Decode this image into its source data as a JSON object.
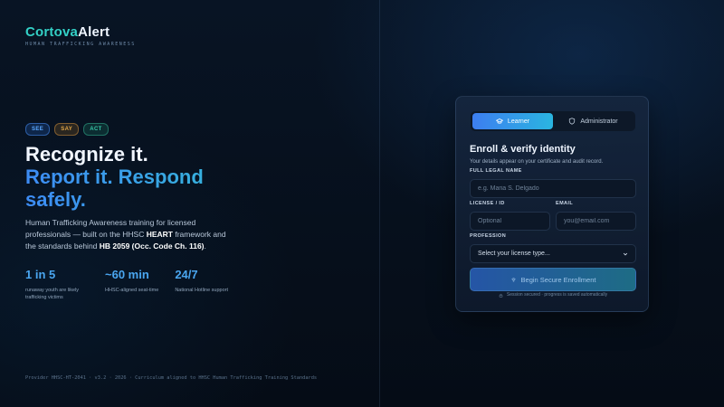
{
  "brand": {
    "name_part1": "Cortova",
    "name_part2": "Alert",
    "subtitle": "HUMAN TRAFFICKING AWARENESS"
  },
  "tags": [
    "SEE",
    "SAY",
    "ACT"
  ],
  "hero": {
    "line1": "Recognize it.",
    "line2": "Report it. Respond safely."
  },
  "description": {
    "text1": "Human Trafficking Awareness training for licensed professionals — built on the HHSC ",
    "bold1": "HEART",
    "text2": " framework and the standards behind ",
    "bold2": "HB 2059 (Occ. Code Ch. 116)",
    "text3": "."
  },
  "stats": [
    {
      "value": "1 in 5",
      "label": "runaway youth are likely trafficking victims"
    },
    {
      "value": "~60 min",
      "label": "HHSC-aligned seat-time"
    },
    {
      "value": "24/7",
      "label": "National Hotline support"
    }
  ],
  "footer": "Provider HHSC-HT-2041 · v3.2 · 2026 · Curriculum aligned to HHSC Human Trafficking Training Standards",
  "card": {
    "tabs": [
      {
        "label": "Learner",
        "icon": "graduation-cap-icon",
        "active": true
      },
      {
        "label": "Administrator",
        "icon": "shield-icon",
        "active": false
      }
    ],
    "title": "Enroll & verify identity",
    "subtitle": "Your details appear on your certificate and audit record.",
    "fields": {
      "full_name": {
        "label": "FULL LEGAL NAME",
        "placeholder": "e.g. Maria S. Delgado",
        "value": ""
      },
      "license": {
        "label": "LICENSE / ID",
        "placeholder": "Optional",
        "value": ""
      },
      "email": {
        "label": "EMAIL",
        "placeholder": "you@email.com",
        "value": ""
      },
      "profession": {
        "label": "PROFESSION",
        "selected": "Select your license type..."
      }
    },
    "submit_label": "Begin Secure Enrollment",
    "secure_note": "Session secured · progress is saved automatically"
  },
  "colors": {
    "accent_blue": "#3d7ef0",
    "accent_teal": "#33d0c6",
    "background": "#07101c"
  }
}
